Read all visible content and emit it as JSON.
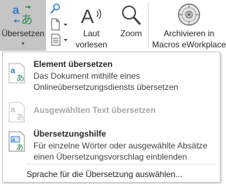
{
  "ribbon": {
    "translate_button": {
      "label": "Übersetzen",
      "caret": "▾",
      "icon": "translate-icon"
    },
    "small_buttons": [
      {
        "icon": "search-icon"
      },
      {
        "icon": "document-dropdown-icon"
      },
      {
        "icon": "text-document-icon"
      }
    ],
    "read_aloud": {
      "label_line1": "Laut",
      "label_line2": "vorlesen",
      "icon": "read-aloud-icon"
    },
    "zoom": {
      "label": "Zoom",
      "icon": "magnifier-icon"
    },
    "archive": {
      "label_line1": "Archivieren in",
      "label_line2": "Macros eWorkplace",
      "icon": "archive-disc-icon"
    }
  },
  "dropdown": {
    "items": [
      {
        "title": "Element übersetzen",
        "description": "Das Dokument mithilfe eines Onlineübersetzungsdiensts übersetzen",
        "icon": "translate-document-icon",
        "enabled": true
      },
      {
        "title": "Ausgewählten Text übersetzen",
        "icon": "translate-selection-icon",
        "enabled": false
      },
      {
        "title": "Übersetzungshilfe",
        "description": "Für einzelne Wörter oder ausgewählte Absätze einen Übersetzungsvorschlag einblenden",
        "icon": "translation-helper-icon",
        "enabled": true
      },
      {
        "title": "Sprache für die Übersetzung auswählen...",
        "enabled": true
      }
    ]
  },
  "colors": {
    "pressed_button_bg": "#c5c5c5",
    "translate_icon_blue": "#2b7cd3",
    "translate_icon_green": "#2e8b57",
    "disabled_text": "#a6a6a6"
  }
}
